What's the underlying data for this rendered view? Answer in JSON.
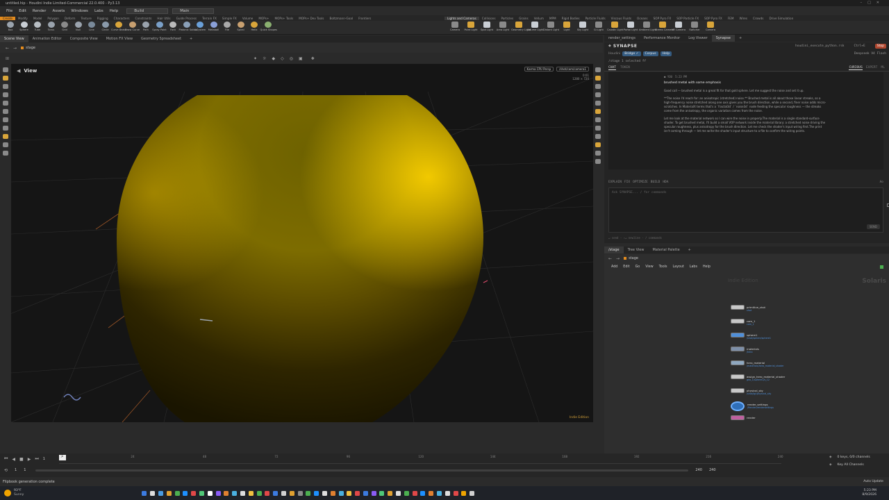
{
  "window": {
    "title": "untitled.hip - Houdini Indie Limited-Commercial 22.0.400 - Py3.13",
    "desktop_build": "Build",
    "desktop_main": "Main"
  },
  "menu": [
    "File",
    "Edit",
    "Render",
    "Assets",
    "Windows",
    "Labs",
    "Help"
  ],
  "shelf_tabs_left": [
    "Create",
    "Modify",
    "Model",
    "Polygon",
    "Deform",
    "Texture",
    "Rigging",
    "Characters",
    "Constraints",
    "Hair Utils",
    "Guide Process",
    "Terrain FX",
    "Simple FX",
    "Volume",
    "MOPs+",
    "MOPs+ Tools",
    "MOPs+ Dev Tools",
    "Boltzmann-Goal",
    "Frontiers"
  ],
  "shelf_tabs_right": [
    "Lights and Cameras",
    "Collisions",
    "Particles",
    "Grains",
    "Vellum",
    "MPM",
    "Rigid Bodies",
    "Particle Fluids",
    "Viscous Fluids",
    "Oceans",
    "SOP Pyro FX",
    "SOP Particle FX",
    "SOP Pyro FX",
    "FEM",
    "Wires",
    "Crowds",
    "Drive Simulation"
  ],
  "shelf_tools_left": [
    "Box",
    "Sphere",
    "Tube",
    "Torus",
    "Grid",
    "Null",
    "Line",
    "Circle",
    "Curve Bezier",
    "Draw Curve",
    "Path",
    "Spray Paint",
    "Font",
    "Platonic Solids",
    "L-System",
    "Metaball",
    "File",
    "Spiral",
    "Helix",
    "Quick Shapes"
  ],
  "shelf_tools_right": [
    "Camera",
    "Point Light",
    "Spot Light",
    "Area Light",
    "Geometry Light",
    "Volume Light",
    "Distant Light",
    "Light",
    "Sky Light",
    "GI Light",
    "Caustic Light",
    "Portal Light",
    "Ambient Light",
    "Stereo Camera",
    "VR Camera",
    "Switcher",
    "Camera"
  ],
  "viewer_tabs": [
    "Scene View",
    "Animation Editor",
    "Composite View",
    "Motion FX View",
    "Geometry Spreadsheet"
  ],
  "viewer": {
    "path": "stage",
    "label": "View",
    "renderer": "Karma CPU  Persp",
    "camera": "/shot/cam/camera1",
    "frame_info": "0:01",
    "res_info": "1280 × 720",
    "watermark": "Indie Edition"
  },
  "right_top_tabs": [
    "render_settings",
    "Performance Monitor",
    "Log Viewer",
    "Synapse"
  ],
  "synapse": {
    "title": "SYNAPSE",
    "subtitle": "Houdini",
    "buttons": [
      "Bridge ✓",
      "Corpus",
      "Help"
    ],
    "script_name": "houdini_execute_python.rsk",
    "shortcut": "Ctrl+E",
    "stop_label": "Stop",
    "model": "Deepseek V4 Flash",
    "context": "/stage  1 selected  ff",
    "tabs": [
      "CHAT",
      "TOKEN"
    ],
    "modes": [
      "CURIOUS",
      "EXPERT",
      "ML"
    ],
    "user_label": "YOU",
    "user_time": "5:23 PM",
    "user_msg": "brushed metal with some emphasis",
    "reply_1": "Good call — brushed metal is a great fit for that gold sphere. Let me suggest the noise and set it up.",
    "reply_2": "**The noise I'd reach for: an anisotropic (stretched) noise.** Brushed metal is all about those linear streaks, so a high-frequency noise stretched along one axis gives you the brush direction, while a second, finer noise adds micro-scratches. In MaterialX terms that's a `fractal3d` / `noise3d` node feeding the specular roughness — the streaks come from the anisotropy, the organic variation comes from the noise.",
    "reply_3": "Let me look at the material network so I can wire the noise in properly.The material is a single standard-surface shader. To get brushed metal, I'll build a small VOP network inside the material library: a stretched noise driving the specular roughness, plus anisotropy for the brush direction. Let me check the shader's input wiring first.The print isn't coming through — let me write the shader's input structure to a file to confirm the wiring points.",
    "actions": [
      "EXPLAIN",
      "FIX",
      "OPTIMIZE",
      "BUILD",
      "HDA"
    ],
    "actions_right": "Ao",
    "input_placeholder": "Ask SYNAPSE...   / for commands",
    "send_label": "SEND",
    "footer_hint": "↵ send  ·  ⇧↵ newline  ·  / commands"
  },
  "net_tabs": [
    "/stage",
    "Tree View",
    "Material Palette"
  ],
  "network": {
    "path": "stage",
    "menu": [
      "Add",
      "Edit",
      "Go",
      "View",
      "Tools",
      "Layout",
      "Labs",
      "Help"
    ],
    "edition": "Indie Edition",
    "context": "Solaris",
    "nodes": [
      {
        "name": "primitive_shot",
        "sub": "shot"
      },
      {
        "name": "cam_1",
        "sub": "cam_1"
      },
      {
        "name": "sphere1",
        "sub": "/shot/sphere/sphere1"
      },
      {
        "name": "materials",
        "sub": "/hero"
      },
      {
        "name": "hero_material",
        "sub": "/materials/hero_material_shader"
      },
      {
        "name": "assign_hero_material_shader",
        "sub": "geo_1/sphere1/s_12"
      },
      {
        "name": "physical_sky",
        "sub": "/shot/lgt/physical_sky"
      },
      {
        "name": "render_settings",
        "sub": "/Render/rendersettings"
      },
      {
        "name": "render",
        "sub": ""
      }
    ]
  },
  "timeline": {
    "current_frame": "1",
    "start": "1",
    "end": "1",
    "ticks": [
      "1",
      "24",
      "48",
      "72",
      "96",
      "120",
      "144",
      "168",
      "192",
      "216",
      "240"
    ],
    "range_end": "240",
    "range_end2": "240",
    "keys_info": "0 keys, 0/0 channels",
    "key_all": "Key All Channels",
    "auto_update": "Auto Update"
  },
  "status": "Flipbook generation complete",
  "taskbar": {
    "temp": "93°F",
    "weather": "Sunny",
    "time": "5:23 PM",
    "date": "8/9/2026"
  },
  "colors": {
    "accent": "#e38b1e",
    "sphere": "#c8a600",
    "link": "#4f8fd9"
  }
}
